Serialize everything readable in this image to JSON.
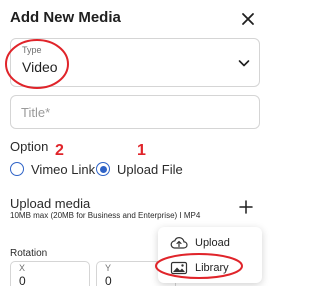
{
  "header": {
    "title": "Add New Media"
  },
  "type_select": {
    "label": "Type",
    "value": "Video"
  },
  "title_input": {
    "placeholder": "Title*",
    "value": ""
  },
  "option": {
    "label": "Option",
    "choices": [
      {
        "label": "Vimeo Link",
        "selected": false
      },
      {
        "label": "Upload File",
        "selected": true
      }
    ]
  },
  "upload_media": {
    "title": "Upload media",
    "subtitle": "10MB max (20MB for Business and Enterprise) I MP4"
  },
  "rotation": {
    "label": "Rotation",
    "x_label": "X",
    "x_value": "0",
    "y_label": "Y",
    "y_value": "0"
  },
  "menu": {
    "items": [
      {
        "label": "Upload",
        "icon": "cloud-upload-icon"
      },
      {
        "label": "Library",
        "icon": "image-library-icon"
      }
    ]
  },
  "annotations": {
    "number_1": "1",
    "number_2": "2",
    "color": "#e0242a"
  },
  "colors": {
    "accent": "#2f63c7",
    "border": "#d5d5d5"
  }
}
